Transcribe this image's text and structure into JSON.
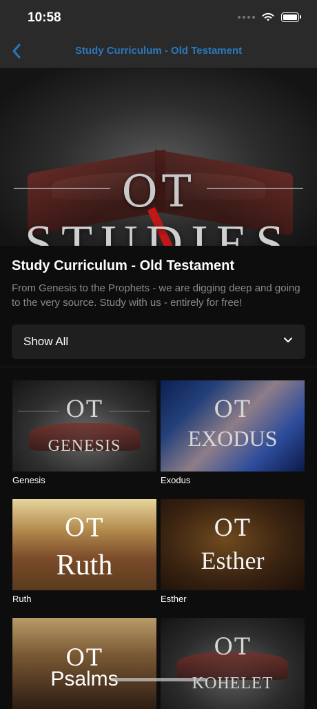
{
  "status_bar": {
    "time": "10:58"
  },
  "nav": {
    "title": "Study Curriculum - Old Testament"
  },
  "hero": {
    "line1": "OT",
    "line2": "STUDIES"
  },
  "header": {
    "title": "Study Curriculum - Old Testament",
    "description": "From Genesis to the Prophets - we are digging deep and going to the very source. Study with us - entirely for free!"
  },
  "filter": {
    "selected": "Show All"
  },
  "studies": [
    {
      "label": "Genesis",
      "art_line1": "OT",
      "art_line2": "GENESIS"
    },
    {
      "label": "Exodus",
      "art_line1": "OT",
      "art_line2": "EXODUS"
    },
    {
      "label": "Ruth",
      "art_line1": "OT",
      "art_line2": "Ruth"
    },
    {
      "label": "Esther",
      "art_line1": "OT",
      "art_line2": "Esther"
    },
    {
      "label": "",
      "art_line1": "OT",
      "art_line2": "Psalms"
    },
    {
      "label": "",
      "art_line1": "OT",
      "art_line2": "KOHELET"
    }
  ],
  "colors": {
    "accent": "#2b78c0",
    "background": "#0d0d0d",
    "bar": "#2a2a2a"
  }
}
